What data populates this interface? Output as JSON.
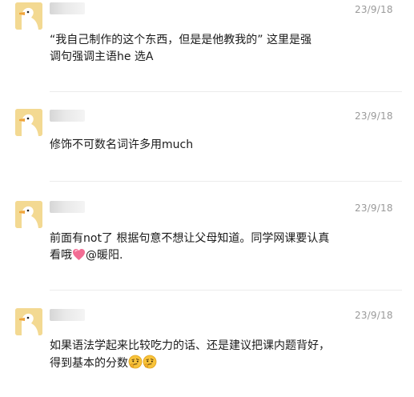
{
  "comments": [
    {
      "date": "23/9/18",
      "lines": [
        "“我自己制作的这个东西，但是是他教我的” 这里是强",
        "调句强调主语he 选A"
      ]
    },
    {
      "date": "23/9/18",
      "lines": [
        "修饰不可数名词许多用much"
      ]
    },
    {
      "date": "23/9/18",
      "lines": [
        "前面有not了 根据句意不想让父母知道。同学网课要认真",
        "看哦"
      ],
      "emoji": "pink-heart-icon",
      "tail": "@暖阳."
    },
    {
      "date": "23/9/18",
      "lines": [
        "如果语法学起来比较吃力的话、还是建议把课内题背好，",
        "得到基本的分数"
      ],
      "emojis": [
        "thinking-face-icon",
        "thinking-face-icon"
      ]
    }
  ],
  "colors": {
    "text": "#1a1a1a",
    "timestamp": "#9a9a9a",
    "avatar_bg": "#f3d992",
    "heart": "#f26c93",
    "emoji_face": "#f8c33a"
  }
}
